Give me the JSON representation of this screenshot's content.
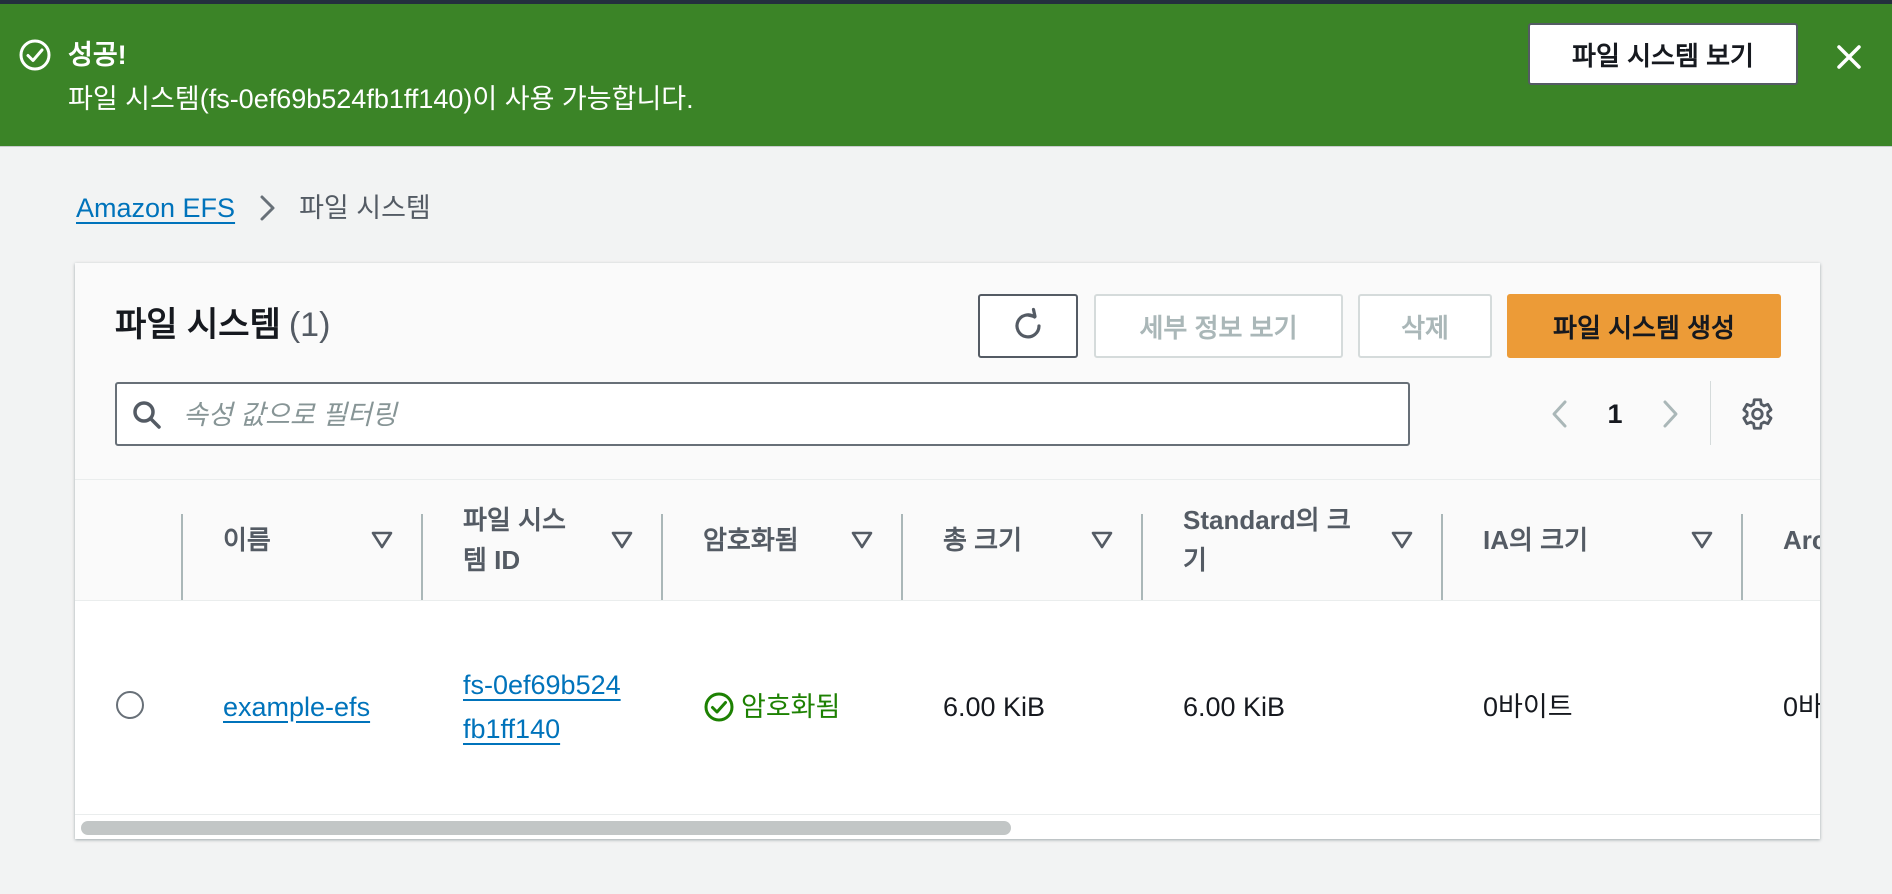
{
  "flash": {
    "title": "성공!",
    "message": "파일 시스템(fs-0ef69b524fb1ff140)이 사용 가능합니다.",
    "view_button": "파일 시스템 보기",
    "color": "#3b8427"
  },
  "breadcrumb": {
    "root": "Amazon EFS",
    "current": "파일 시스템"
  },
  "panel": {
    "title": "파일 시스템",
    "count": "(1)",
    "buttons": {
      "details": "세부 정보 보기",
      "delete": "삭제",
      "create": "파일 시스템 생성"
    },
    "search_placeholder": "속성 값으로 필터링",
    "page_number": "1"
  },
  "table": {
    "columns": [
      "이름",
      "파일 시스템 ID",
      "암호화됨",
      "총 크기",
      "Standard의 크기",
      "IA의 크기",
      "Arc"
    ],
    "rows": [
      {
        "name": "example-efs",
        "id": "fs-0ef69b524fb1ff140",
        "encrypted": "암호화됨",
        "total_size": "6.00 KiB",
        "standard_size": "6.00 KiB",
        "ia_size": "0바이트",
        "archive_size": "0바"
      }
    ]
  },
  "icons": {
    "flash": "success-check-icon",
    "refresh": "refresh-icon",
    "search": "search-icon",
    "settings": "gear-icon"
  },
  "colors": {
    "link": "#0073bb",
    "primary_button": "#ec9b37",
    "success_text": "#1d8102"
  }
}
